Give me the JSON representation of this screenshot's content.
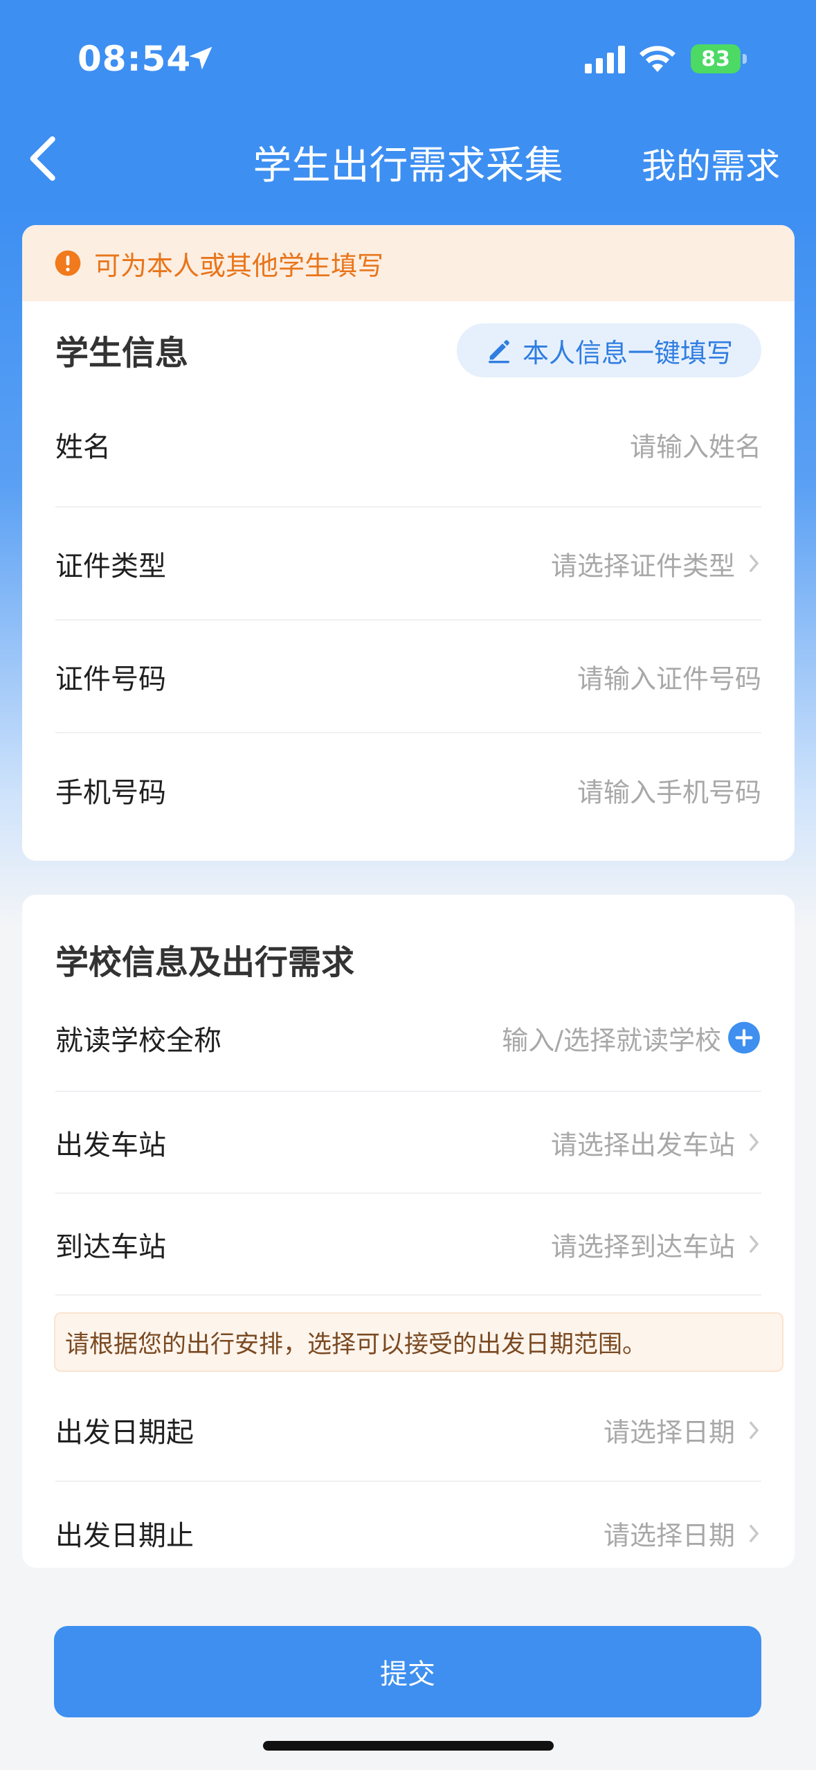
{
  "status_bar": {
    "time": "08:54",
    "battery": "83"
  },
  "nav": {
    "title": "学生出行需求采集",
    "right_link": "我的需求"
  },
  "notice": {
    "text": "可为本人或其他学生填写",
    "color": "#e8751a"
  },
  "student_section": {
    "title": "学生信息",
    "autofill_label": "本人信息一键填写",
    "fields": [
      {
        "label": "姓名",
        "placeholder": "请输入姓名"
      },
      {
        "label": "证件类型",
        "placeholder": "请选择证件类型"
      },
      {
        "label": "证件号码",
        "placeholder": "请输入证件号码"
      },
      {
        "label": "手机号码",
        "placeholder": "请输入手机号码"
      }
    ]
  },
  "school_section": {
    "title": "学校信息及出行需求",
    "fields": [
      {
        "label": "就读学校全称",
        "placeholder": "输入/选择就读学校"
      },
      {
        "label": "出发车站",
        "placeholder": "请选择出发车站"
      },
      {
        "label": "到达车站",
        "placeholder": "请选择到达车站"
      }
    ],
    "tip": "请根据您的出行安排，选择可以接受的出发日期范围。",
    "date_fields": [
      {
        "label": "出发日期起",
        "placeholder": "请选择日期"
      },
      {
        "label": "出发日期止",
        "placeholder": "请选择日期"
      }
    ]
  },
  "submit_label": "提交",
  "accent_color": "#3e8ff0"
}
